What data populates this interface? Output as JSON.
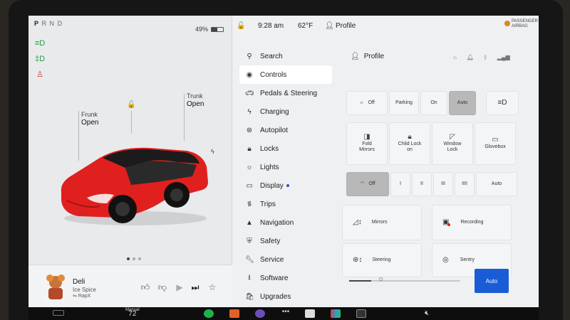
{
  "gear": [
    "P",
    "R",
    "N",
    "D"
  ],
  "gear_selected": "P",
  "battery": {
    "percent": "49%",
    "level": 0.49
  },
  "status": {
    "time": "9:28 am",
    "temp": "62°F",
    "profile": "Profile"
  },
  "passenger_airbag": [
    "PASSENGER",
    "AIRBAG"
  ],
  "frunk": {
    "label": "Frunk",
    "state": "Open"
  },
  "trunk": {
    "label": "Trunk",
    "state": "Open"
  },
  "car_color": "#e0201e",
  "menu": [
    {
      "label": "Search",
      "icon": "search-icon"
    },
    {
      "label": "Controls",
      "icon": "toggle-icon",
      "active": true
    },
    {
      "label": "Pedals & Steering",
      "icon": "car-icon"
    },
    {
      "label": "Charging",
      "icon": "bolt-icon"
    },
    {
      "label": "Autopilot",
      "icon": "steering-wheel-icon"
    },
    {
      "label": "Locks",
      "icon": "lock-icon"
    },
    {
      "label": "Lights",
      "icon": "lightbulb-icon"
    },
    {
      "label": "Display",
      "icon": "display-icon",
      "dot": true
    },
    {
      "label": "Trips",
      "icon": "trips-icon"
    },
    {
      "label": "Navigation",
      "icon": "navigation-icon"
    },
    {
      "label": "Safety",
      "icon": "safety-icon"
    },
    {
      "label": "Service",
      "icon": "wrench-icon"
    },
    {
      "label": "Software",
      "icon": "download-icon"
    },
    {
      "label": "Upgrades",
      "icon": "bag-icon"
    }
  ],
  "content": {
    "profile": "Profile",
    "lights": [
      "Off",
      "Parking",
      "On",
      "Auto"
    ],
    "lights_selected": "Auto",
    "toggles": {
      "fold_mirrors": [
        "Fold",
        "Mirrors"
      ],
      "child_lock": [
        "Child Lock",
        "on"
      ],
      "window_lock": [
        "Window",
        "Lock"
      ],
      "glovebox": "Glovebox"
    },
    "wipers": [
      "Off",
      "I",
      "II",
      "III",
      "IIII",
      "Auto"
    ],
    "wipers_selected": "Off",
    "mirrors": "Mirrors",
    "recording": "Recording",
    "steering": "Steering",
    "sentry": "Sentry",
    "brightness_level": 0.2,
    "auto": "Auto"
  },
  "media": {
    "song": "Deli",
    "artist": "Ice Spice",
    "source": "RapX"
  },
  "cabin_temp": {
    "mode": "Manual",
    "value": "72"
  },
  "accent_blue": "#1a5cd6"
}
